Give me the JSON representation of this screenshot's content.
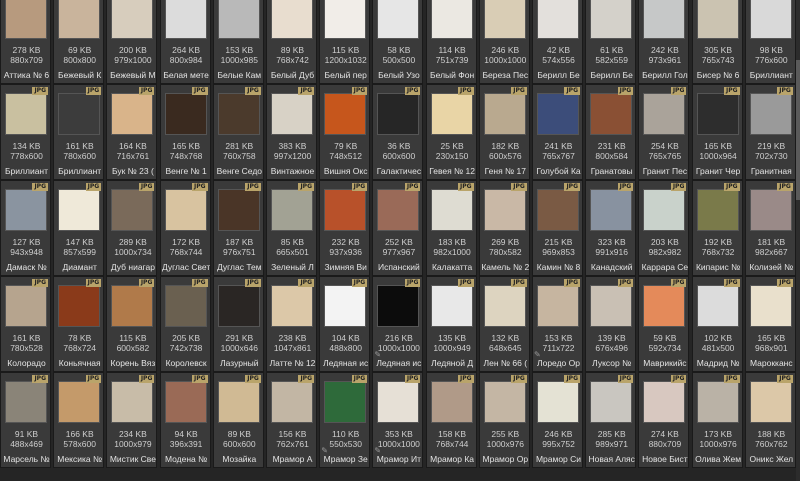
{
  "badge_label": "JPG",
  "columns": 15,
  "tiles": [
    {
      "size": "278 KB",
      "dims": "880x709",
      "name": "Аттика № 6",
      "color": "#b79a7e"
    },
    {
      "size": "69 KB",
      "dims": "800x800",
      "name": "Бежевый К",
      "color": "#c9b49c"
    },
    {
      "size": "200 KB",
      "dims": "979x1000",
      "name": "Бежевый М",
      "color": "#d7cdbd"
    },
    {
      "size": "264 KB",
      "dims": "800x984",
      "name": "Белая мете",
      "color": "#dcdcdc"
    },
    {
      "size": "153 KB",
      "dims": "1000x985",
      "name": "Белые Кам",
      "color": "#b9b9b9"
    },
    {
      "size": "89 KB",
      "dims": "768x742",
      "name": "Белый Дуб",
      "color": "#e8ddcf"
    },
    {
      "size": "115 KB",
      "dims": "1200x1032",
      "name": "Белый пер",
      "color": "#f1ede8"
    },
    {
      "size": "58 KB",
      "dims": "500x500",
      "name": "Белый Узо",
      "color": "#e6e6e6"
    },
    {
      "size": "114 KB",
      "dims": "751x739",
      "name": "Белый Фон",
      "color": "#ebe8e2"
    },
    {
      "size": "246 KB",
      "dims": "1000x1000",
      "name": "Береза Пес",
      "color": "#d9cdb5"
    },
    {
      "size": "42 KB",
      "dims": "574x556",
      "name": "Берилл Бе",
      "color": "#e3e0dc"
    },
    {
      "size": "61 KB",
      "dims": "582x559",
      "name": "Берилл Бе",
      "color": "#d4d1ca"
    },
    {
      "size": "242 KB",
      "dims": "973x961",
      "name": "Берилл Гол",
      "color": "#c6c8c8"
    },
    {
      "size": "305 KB",
      "dims": "765x743",
      "name": "Бисер № 6",
      "color": "#cbc3b1"
    },
    {
      "size": "98 KB",
      "dims": "776x600",
      "name": "Бриллиант",
      "color": "#d9d9d9"
    },
    {
      "size": "134 KB",
      "dims": "778x600",
      "name": "Бриллиант",
      "color": "#c9c0a0"
    },
    {
      "size": "161 KB",
      "dims": "780x600",
      "name": "Бриллиант",
      "color": "#3c3c3c"
    },
    {
      "size": "164 KB",
      "dims": "716x761",
      "name": "Бук № 23 (",
      "color": "#d9b48a"
    },
    {
      "size": "165 KB",
      "dims": "748x768",
      "name": "Венге № 1",
      "color": "#3a2a1f"
    },
    {
      "size": "281 KB",
      "dims": "760x758",
      "name": "Венге Седо",
      "color": "#4b3a2c"
    },
    {
      "size": "383 KB",
      "dims": "997x1200",
      "name": "Винтажное",
      "color": "#d8d2c6"
    },
    {
      "size": "79 KB",
      "dims": "748x512",
      "name": "Вишня Окс",
      "color": "#c6561c"
    },
    {
      "size": "36 KB",
      "dims": "600x600",
      "name": "Галактичес",
      "color": "#262626"
    },
    {
      "size": "25 KB",
      "dims": "230x150",
      "name": "Гевея № 12",
      "color": "#e9d5a6"
    },
    {
      "size": "182 KB",
      "dims": "600x576",
      "name": "Геня № 17",
      "color": "#b9a98f"
    },
    {
      "size": "241 KB",
      "dims": "765x767",
      "name": "Голубой Ка",
      "color": "#3c4d7a"
    },
    {
      "size": "231 KB",
      "dims": "800x584",
      "name": "Гранатовы",
      "color": "#8a5034"
    },
    {
      "size": "254 KB",
      "dims": "765x765",
      "name": "Гранит Пес",
      "color": "#aaa39a"
    },
    {
      "size": "165 KB",
      "dims": "1000x964",
      "name": "Гранит Чер",
      "color": "#2d2d2d"
    },
    {
      "size": "219 KB",
      "dims": "702x730",
      "name": "Гранитная",
      "color": "#9a9a9a"
    },
    {
      "size": "127 KB",
      "dims": "943x948",
      "name": "Дамаск №",
      "color": "#8a94a0"
    },
    {
      "size": "147 KB",
      "dims": "857x599",
      "name": "Диамант",
      "color": "#efe9d9"
    },
    {
      "size": "289 KB",
      "dims": "1000x734",
      "name": "Дуб ниагар",
      "color": "#7a6a5a"
    },
    {
      "size": "172 KB",
      "dims": "768x744",
      "name": "Дуглас Свет",
      "color": "#d8c3a0"
    },
    {
      "size": "187 KB",
      "dims": "976x751",
      "name": "Дуглас Тем",
      "color": "#4a3527"
    },
    {
      "size": "85 KB",
      "dims": "665x501",
      "name": "Зеленый Л",
      "color": "#a2a294"
    },
    {
      "size": "232 KB",
      "dims": "937x936",
      "name": "Зимняя Ви",
      "color": "#b8512a"
    },
    {
      "size": "252 KB",
      "dims": "977x967",
      "name": "Испанский",
      "color": "#9a6a58"
    },
    {
      "size": "183 KB",
      "dims": "982x1000",
      "name": "Калакатта",
      "color": "#dedcd2"
    },
    {
      "size": "269 KB",
      "dims": "780x582",
      "name": "Камель № 2",
      "color": "#c9b8a6"
    },
    {
      "size": "215 KB",
      "dims": "969x853",
      "name": "Камин № 8",
      "color": "#7a5a44"
    },
    {
      "size": "323 KB",
      "dims": "991x916",
      "name": "Канадский",
      "color": "#8892a0"
    },
    {
      "size": "203 KB",
      "dims": "982x982",
      "name": "Каррара Се",
      "color": "#c9d2cb"
    },
    {
      "size": "192 KB",
      "dims": "768x732",
      "name": "Кипарис №",
      "color": "#7a7a4a"
    },
    {
      "size": "181 KB",
      "dims": "982x667",
      "name": "Колизей №",
      "color": "#9a8a88"
    },
    {
      "size": "161 KB",
      "dims": "780x528",
      "name": "Колорадо",
      "color": "#b6a48e"
    },
    {
      "size": "78 KB",
      "dims": "768x724",
      "name": "Коньячная",
      "color": "#8a3a1a"
    },
    {
      "size": "115 KB",
      "dims": "600x582",
      "name": "Корень Вяз",
      "color": "#b07a4a"
    },
    {
      "size": "205 KB",
      "dims": "742x738",
      "name": "Королевск",
      "color": "#6a6050"
    },
    {
      "size": "291 KB",
      "dims": "1000x646",
      "name": "Лазурный",
      "color": "#2a2624"
    },
    {
      "size": "238 KB",
      "dims": "1047x861",
      "name": "Латте № 12",
      "color": "#dcc8a8"
    },
    {
      "size": "104 KB",
      "dims": "488x800",
      "name": "Ледяная ис",
      "color": "#f3f3f3"
    },
    {
      "size": "216 KB",
      "dims": "1000x1000",
      "name": "Ледяная ис",
      "color": "#0c0c0c"
    },
    {
      "size": "135 KB",
      "dims": "1000x949",
      "name": "Ледяной Д",
      "color": "#e8e8e8"
    },
    {
      "size": "132 KB",
      "dims": "648x645",
      "name": "Лен № 66 (",
      "color": "#ddd4c0"
    },
    {
      "size": "153 KB",
      "dims": "711x722",
      "name": "Лоредо Ор",
      "color": "#c6b5a0"
    },
    {
      "size": "139 KB",
      "dims": "676x496",
      "name": "Луксор №",
      "color": "#c9c0b4"
    },
    {
      "size": "59 KB",
      "dims": "592x734",
      "name": "Маврикийс",
      "color": "#e48a5a"
    },
    {
      "size": "102 KB",
      "dims": "481x500",
      "name": "Мадрид №",
      "color": "#dcdcdc"
    },
    {
      "size": "165 KB",
      "dims": "968x901",
      "name": "Марокканс",
      "color": "#e9e0cc"
    },
    {
      "size": "91 KB",
      "dims": "488x469",
      "name": "Марсель №",
      "color": "#8a8478"
    },
    {
      "size": "166 KB",
      "dims": "578x600",
      "name": "Мексика №",
      "color": "#c49a6a"
    },
    {
      "size": "234 KB",
      "dims": "1000x979",
      "name": "Мистик Све",
      "color": "#c8bca8"
    },
    {
      "size": "94 KB",
      "dims": "396x391",
      "name": "Модена №",
      "color": "#9a6a56"
    },
    {
      "size": "89 KB",
      "dims": "600x600",
      "name": "Мозайка",
      "color": "#d0ba94"
    },
    {
      "size": "156 KB",
      "dims": "762x761",
      "name": "Мрамор А",
      "color": "#c2b6a4"
    },
    {
      "size": "110 KB",
      "dims": "550x530",
      "name": "Мрамор Зе",
      "color": "#2e6a3a"
    },
    {
      "size": "353 KB",
      "dims": "1000x1000",
      "name": "Мрамор Ит",
      "color": "#e6e0d6"
    },
    {
      "size": "158 KB",
      "dims": "768x744",
      "name": "Мрамор Ка",
      "color": "#b09a88"
    },
    {
      "size": "255 KB",
      "dims": "1000x976",
      "name": "Мрамор Ор",
      "color": "#c4b6a4"
    },
    {
      "size": "246 KB",
      "dims": "995x752",
      "name": "Мрамор Си",
      "color": "#e4e2d4"
    },
    {
      "size": "285 KB",
      "dims": "989x971",
      "name": "Новая Аляс",
      "color": "#c9c6c0"
    },
    {
      "size": "274 KB",
      "dims": "880x709",
      "name": "Новое Бист",
      "color": "#d8c8c0"
    },
    {
      "size": "173 KB",
      "dims": "1000x976",
      "name": "Олива Жем",
      "color": "#bab2a6"
    },
    {
      "size": "188 KB",
      "dims": "760x762",
      "name": "Оникс Жел",
      "color": "#dcc8a8"
    }
  ],
  "edit_marks": [
    52,
    55,
    66,
    67
  ],
  "top_row": [
    {
      "size": "278 KB",
      "dims": "880x709",
      "name": "Аттика № 6"
    }
  ]
}
